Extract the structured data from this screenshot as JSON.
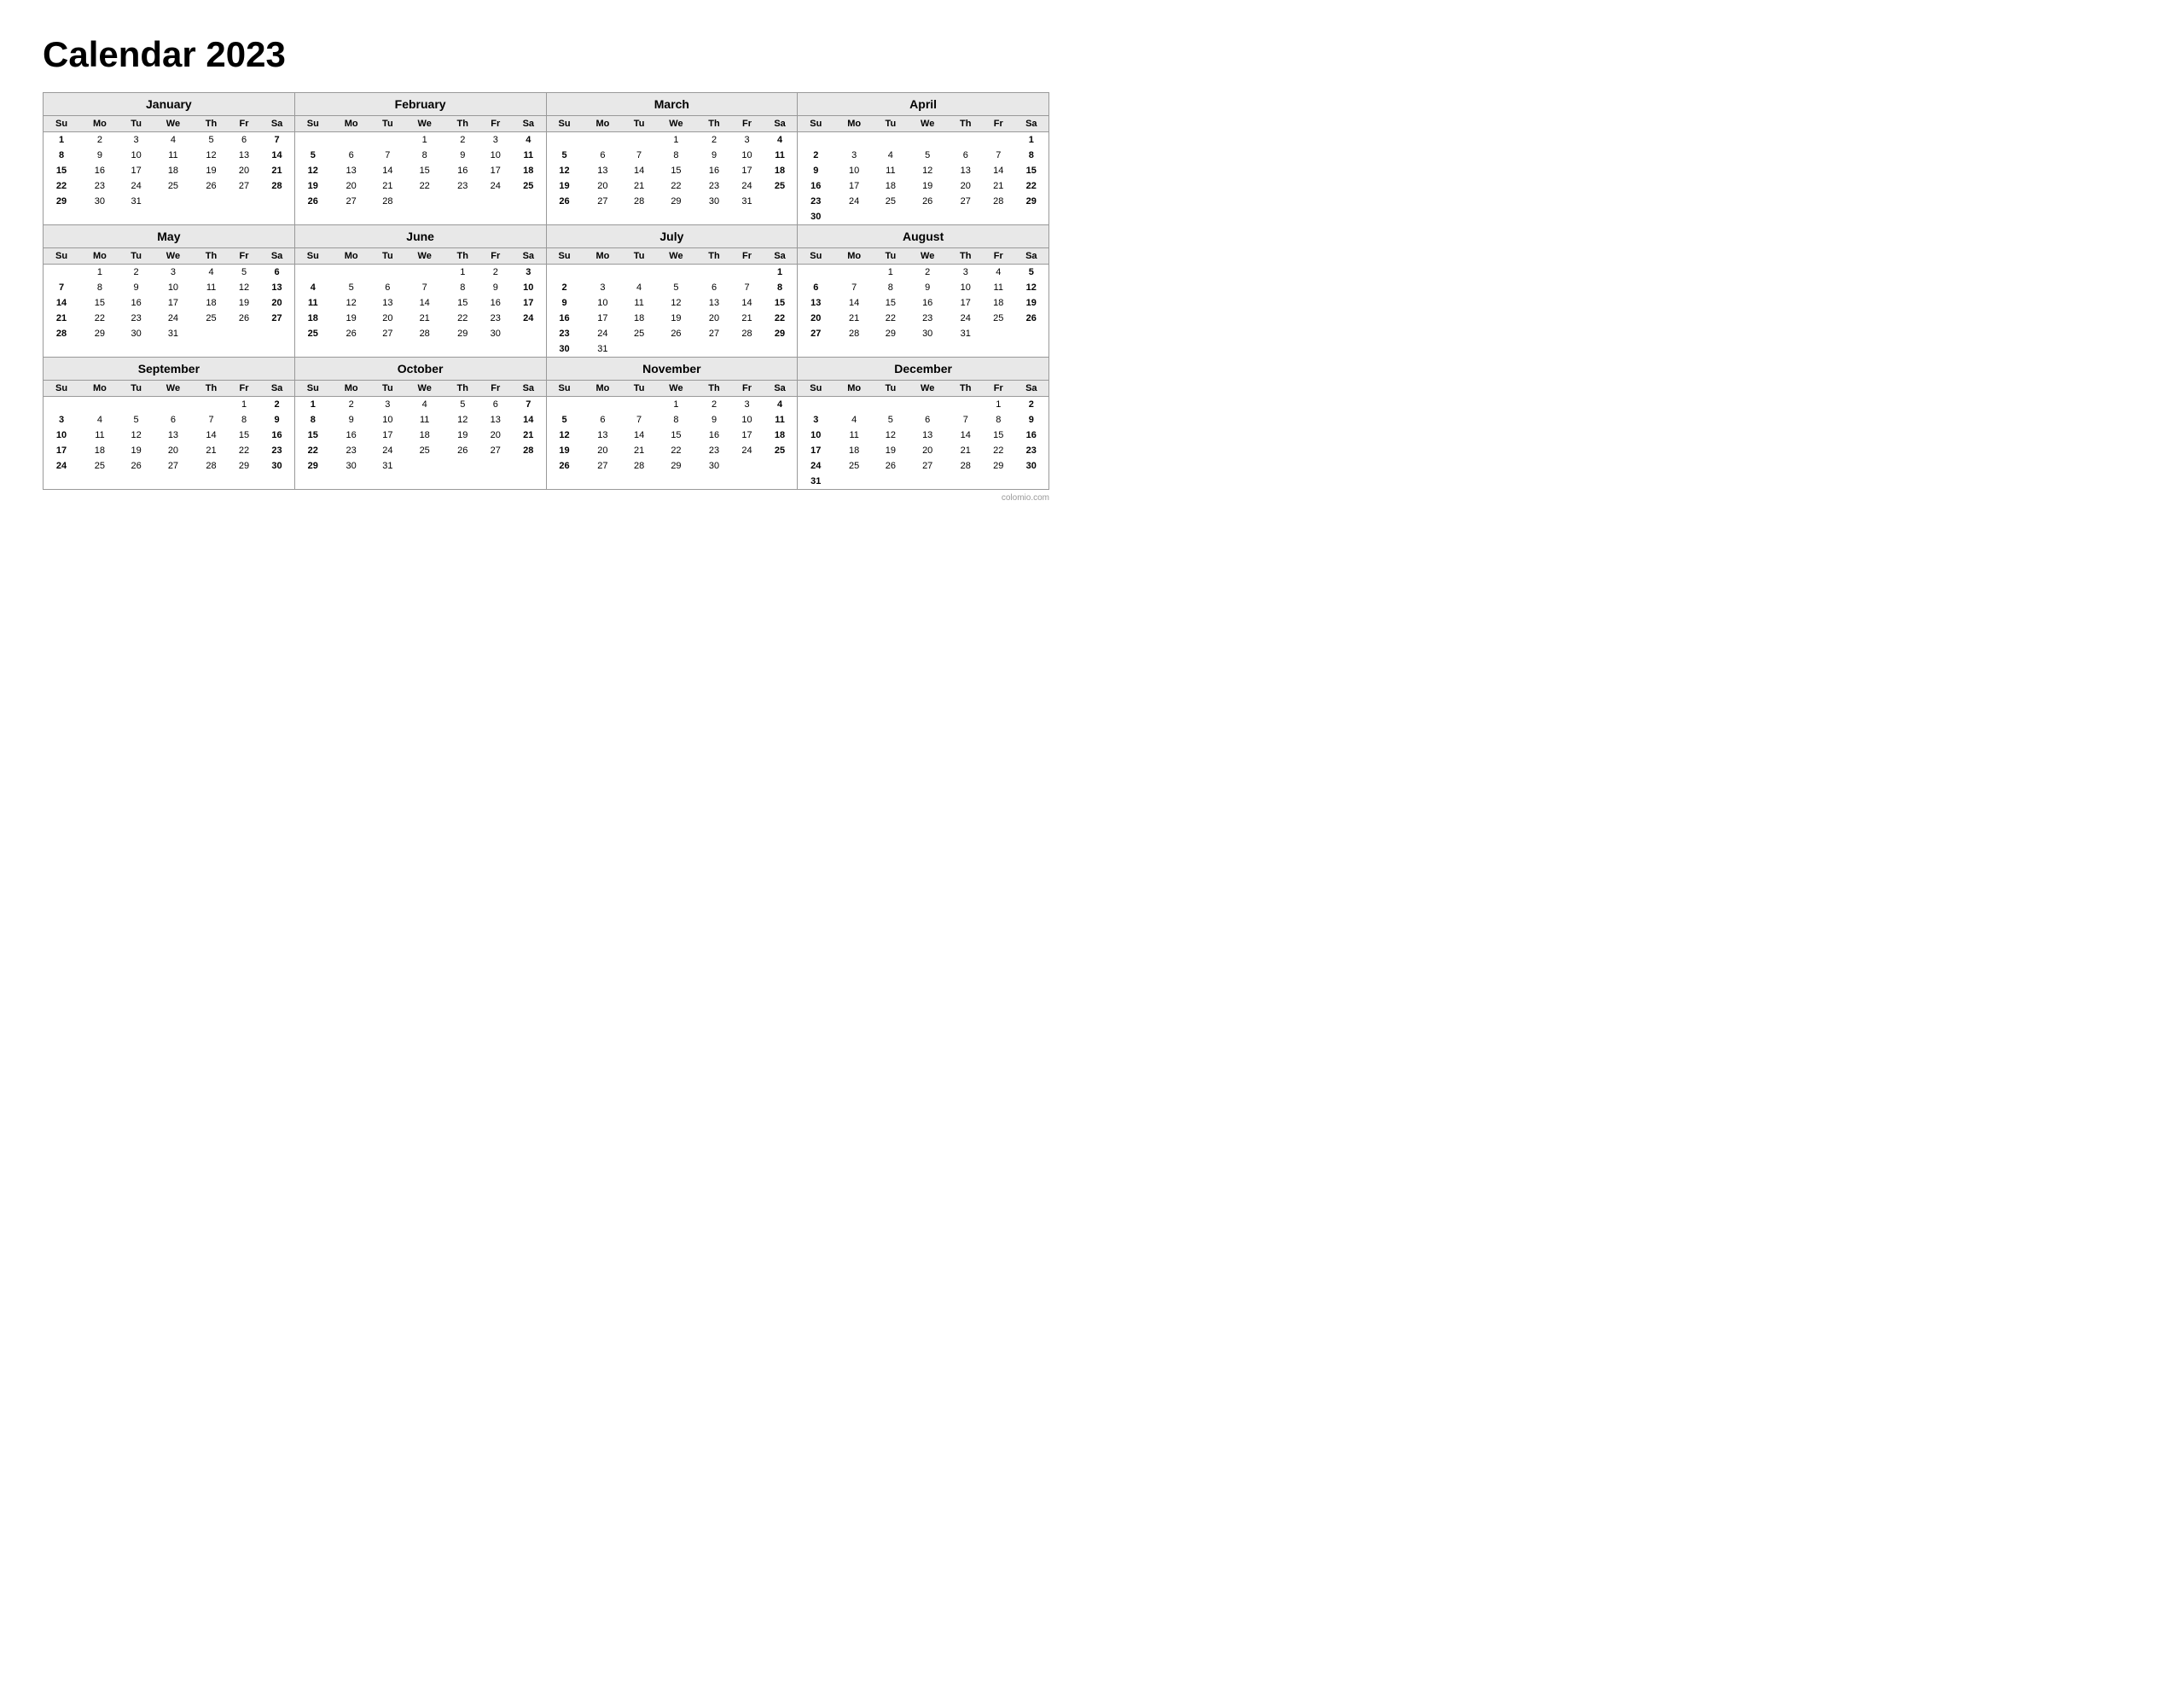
{
  "title": "Calendar 2023",
  "watermark": "colomio.com",
  "months": [
    {
      "name": "January",
      "weeks": [
        [
          "1",
          "2",
          "3",
          "4",
          "5",
          "6",
          "7"
        ],
        [
          "8",
          "9",
          "10",
          "11",
          "12",
          "13",
          "14"
        ],
        [
          "15",
          "16",
          "17",
          "18",
          "19",
          "20",
          "21"
        ],
        [
          "22",
          "23",
          "24",
          "25",
          "26",
          "27",
          "28"
        ],
        [
          "29",
          "30",
          "31",
          "",
          "",
          "",
          ""
        ],
        [
          "",
          "",
          "",
          "",
          "",
          "",
          ""
        ]
      ]
    },
    {
      "name": "February",
      "weeks": [
        [
          "",
          "",
          "",
          "1",
          "2",
          "3",
          "4"
        ],
        [
          "5",
          "6",
          "7",
          "8",
          "9",
          "10",
          "11"
        ],
        [
          "12",
          "13",
          "14",
          "15",
          "16",
          "17",
          "18"
        ],
        [
          "19",
          "20",
          "21",
          "22",
          "23",
          "24",
          "25"
        ],
        [
          "26",
          "27",
          "28",
          "",
          "",
          "",
          ""
        ],
        [
          "",
          "",
          "",
          "",
          "",
          "",
          ""
        ]
      ]
    },
    {
      "name": "March",
      "weeks": [
        [
          "",
          "",
          "",
          "1",
          "2",
          "3",
          "4"
        ],
        [
          "5",
          "6",
          "7",
          "8",
          "9",
          "10",
          "11"
        ],
        [
          "12",
          "13",
          "14",
          "15",
          "16",
          "17",
          "18"
        ],
        [
          "19",
          "20",
          "21",
          "22",
          "23",
          "24",
          "25"
        ],
        [
          "26",
          "27",
          "28",
          "29",
          "30",
          "31",
          ""
        ],
        [
          "",
          "",
          "",
          "",
          "",
          "",
          ""
        ]
      ]
    },
    {
      "name": "April",
      "weeks": [
        [
          "",
          "",
          "",
          "",
          "",
          "",
          "1"
        ],
        [
          "2",
          "3",
          "4",
          "5",
          "6",
          "7",
          "8"
        ],
        [
          "9",
          "10",
          "11",
          "12",
          "13",
          "14",
          "15"
        ],
        [
          "16",
          "17",
          "18",
          "19",
          "20",
          "21",
          "22"
        ],
        [
          "23",
          "24",
          "25",
          "26",
          "27",
          "28",
          "29"
        ],
        [
          "30",
          "",
          "",
          "",
          "",
          "",
          ""
        ]
      ]
    },
    {
      "name": "May",
      "weeks": [
        [
          "",
          "1",
          "2",
          "3",
          "4",
          "5",
          "6"
        ],
        [
          "7",
          "8",
          "9",
          "10",
          "11",
          "12",
          "13"
        ],
        [
          "14",
          "15",
          "16",
          "17",
          "18",
          "19",
          "20"
        ],
        [
          "21",
          "22",
          "23",
          "24",
          "25",
          "26",
          "27"
        ],
        [
          "28",
          "29",
          "30",
          "31",
          "",
          "",
          ""
        ],
        [
          "",
          "",
          "",
          "",
          "",
          "",
          ""
        ]
      ]
    },
    {
      "name": "June",
      "weeks": [
        [
          "",
          "",
          "",
          "",
          "1",
          "2",
          "3"
        ],
        [
          "4",
          "5",
          "6",
          "7",
          "8",
          "9",
          "10"
        ],
        [
          "11",
          "12",
          "13",
          "14",
          "15",
          "16",
          "17"
        ],
        [
          "18",
          "19",
          "20",
          "21",
          "22",
          "23",
          "24"
        ],
        [
          "25",
          "26",
          "27",
          "28",
          "29",
          "30",
          ""
        ],
        [
          "",
          "",
          "",
          "",
          "",
          "",
          ""
        ]
      ]
    },
    {
      "name": "July",
      "weeks": [
        [
          "",
          "",
          "",
          "",
          "",
          "",
          "1"
        ],
        [
          "2",
          "3",
          "4",
          "5",
          "6",
          "7",
          "8"
        ],
        [
          "9",
          "10",
          "11",
          "12",
          "13",
          "14",
          "15"
        ],
        [
          "16",
          "17",
          "18",
          "19",
          "20",
          "21",
          "22"
        ],
        [
          "23",
          "24",
          "25",
          "26",
          "27",
          "28",
          "29"
        ],
        [
          "30",
          "31",
          "",
          "",
          "",
          "",
          ""
        ]
      ]
    },
    {
      "name": "August",
      "weeks": [
        [
          "",
          "",
          "1",
          "2",
          "3",
          "4",
          "5"
        ],
        [
          "6",
          "7",
          "8",
          "9",
          "10",
          "11",
          "12"
        ],
        [
          "13",
          "14",
          "15",
          "16",
          "17",
          "18",
          "19"
        ],
        [
          "20",
          "21",
          "22",
          "23",
          "24",
          "25",
          "26"
        ],
        [
          "27",
          "28",
          "29",
          "30",
          "31",
          "",
          ""
        ],
        [
          "",
          "",
          "",
          "",
          "",
          "",
          ""
        ]
      ]
    },
    {
      "name": "September",
      "weeks": [
        [
          "",
          "",
          "",
          "",
          "",
          "1",
          "2"
        ],
        [
          "3",
          "4",
          "5",
          "6",
          "7",
          "8",
          "9"
        ],
        [
          "10",
          "11",
          "12",
          "13",
          "14",
          "15",
          "16"
        ],
        [
          "17",
          "18",
          "19",
          "20",
          "21",
          "22",
          "23"
        ],
        [
          "24",
          "25",
          "26",
          "27",
          "28",
          "29",
          "30"
        ],
        [
          "",
          "",
          "",
          "",
          "",
          "",
          ""
        ]
      ]
    },
    {
      "name": "October",
      "weeks": [
        [
          "1",
          "2",
          "3",
          "4",
          "5",
          "6",
          "7"
        ],
        [
          "8",
          "9",
          "10",
          "11",
          "12",
          "13",
          "14"
        ],
        [
          "15",
          "16",
          "17",
          "18",
          "19",
          "20",
          "21"
        ],
        [
          "22",
          "23",
          "24",
          "25",
          "26",
          "27",
          "28"
        ],
        [
          "29",
          "30",
          "31",
          "",
          "",
          "",
          ""
        ],
        [
          "",
          "",
          "",
          "",
          "",
          "",
          ""
        ]
      ]
    },
    {
      "name": "November",
      "weeks": [
        [
          "",
          "",
          "",
          "1",
          "2",
          "3",
          "4"
        ],
        [
          "5",
          "6",
          "7",
          "8",
          "9",
          "10",
          "11"
        ],
        [
          "12",
          "13",
          "14",
          "15",
          "16",
          "17",
          "18"
        ],
        [
          "19",
          "20",
          "21",
          "22",
          "23",
          "24",
          "25"
        ],
        [
          "26",
          "27",
          "28",
          "29",
          "30",
          "",
          ""
        ],
        [
          "",
          "",
          "",
          "",
          "",
          "",
          ""
        ]
      ]
    },
    {
      "name": "December",
      "weeks": [
        [
          "",
          "",
          "",
          "",
          "",
          "1",
          "2"
        ],
        [
          "3",
          "4",
          "5",
          "6",
          "7",
          "8",
          "9"
        ],
        [
          "10",
          "11",
          "12",
          "13",
          "14",
          "15",
          "16"
        ],
        [
          "17",
          "18",
          "19",
          "20",
          "21",
          "22",
          "23"
        ],
        [
          "24",
          "25",
          "26",
          "27",
          "28",
          "29",
          "30"
        ],
        [
          "31",
          "",
          "",
          "",
          "",
          "",
          ""
        ]
      ]
    }
  ],
  "days": [
    "Su",
    "Mo",
    "Tu",
    "We",
    "Th",
    "Fr",
    "Sa"
  ]
}
